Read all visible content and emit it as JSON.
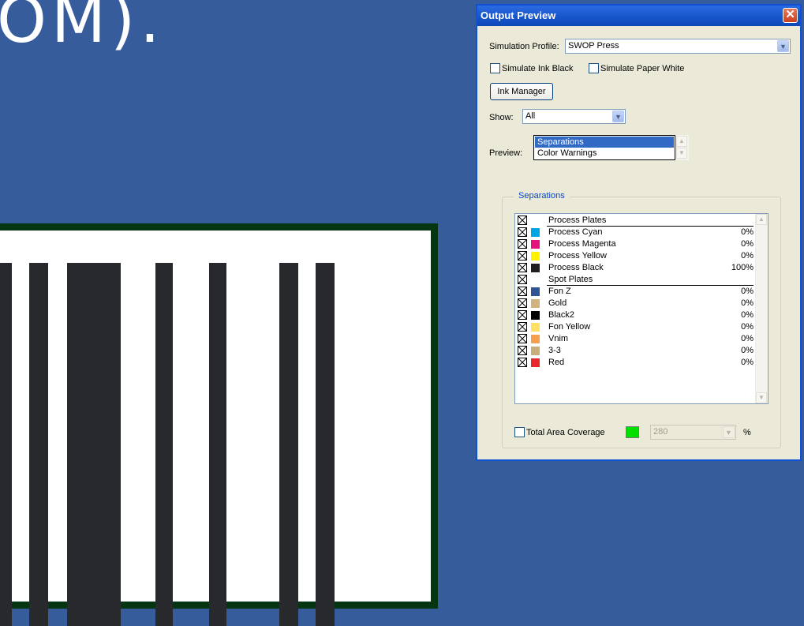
{
  "background": {
    "big_text": "OM).",
    "colors": {
      "canvas": "#365C9C",
      "card": "#FFFFFF",
      "card_border": "#063511",
      "bars": "#28292D"
    }
  },
  "dialog": {
    "title": "Output Preview",
    "simulation_profile": {
      "label": "Simulation Profile:",
      "value": "SWOP Press"
    },
    "simulate_ink_black": {
      "label": "Simulate Ink Black",
      "checked": false
    },
    "simulate_paper_white": {
      "label": "Simulate Paper White",
      "checked": false
    },
    "ink_manager_label": "Ink Manager",
    "show": {
      "label": "Show:",
      "value": "All"
    },
    "preview": {
      "label": "Preview:",
      "options": [
        "Separations",
        "Color Warnings"
      ],
      "selected": "Separations"
    },
    "separations_group_label": "Separations",
    "separations": [
      {
        "type": "header",
        "name": "Process Plates"
      },
      {
        "type": "ink",
        "name": "Process Cyan",
        "color": "#00A6E4",
        "percent": "0%"
      },
      {
        "type": "ink",
        "name": "Process Magenta",
        "color": "#E3137B",
        "percent": "0%"
      },
      {
        "type": "ink",
        "name": "Process Yellow",
        "color": "#FFF200",
        "percent": "0%"
      },
      {
        "type": "ink",
        "name": "Process Black",
        "color": "#231F20",
        "percent": "100%"
      },
      {
        "type": "header",
        "name": "Spot Plates"
      },
      {
        "type": "ink",
        "name": "Fon Z",
        "color": "#2F5596",
        "percent": "0%"
      },
      {
        "type": "ink",
        "name": "Gold",
        "color": "#D2B37F",
        "percent": "0%"
      },
      {
        "type": "ink",
        "name": "Black2",
        "color": "#000000",
        "percent": "0%"
      },
      {
        "type": "ink",
        "name": "Fon Yellow",
        "color": "#FFE063",
        "percent": "0%"
      },
      {
        "type": "ink",
        "name": "Vnim",
        "color": "#F4A04E",
        "percent": "0%"
      },
      {
        "type": "ink",
        "name": "3-3",
        "color": "#C8AE7C",
        "percent": "0%"
      },
      {
        "type": "ink",
        "name": "Red",
        "color": "#E8272E",
        "percent": "0%"
      }
    ],
    "total_area_coverage": {
      "label": "Total Area Coverage",
      "checked": false,
      "swatch_color": "#00E000",
      "value": "280",
      "unit": "%"
    },
    "colors": {
      "title_bar": "#1453C8",
      "face": "#EBE9D8",
      "accent": "#316AC5",
      "group_label": "#0046D5"
    }
  }
}
